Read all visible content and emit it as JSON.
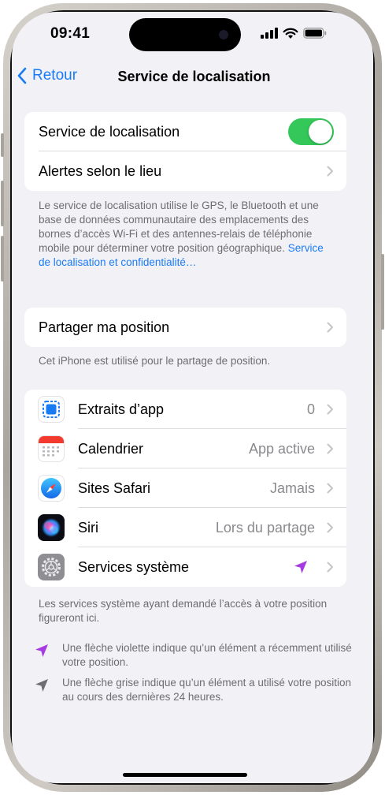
{
  "status_bar": {
    "time": "09:41"
  },
  "nav": {
    "back_label": "Retour",
    "title": "Service de localisation"
  },
  "location_group": {
    "toggle": {
      "label": "Service de localisation",
      "on": true
    },
    "alerts": {
      "label": "Alertes selon le lieu"
    }
  },
  "location_footer": {
    "text": "Le service de localisation utilise le GPS, le Bluetooth et une base de données communautaire des emplacements des bornes d’accès Wi-Fi et des antennes-relais de téléphonie mobile pour déterminer votre position géographique.",
    "link": "Service de localisation et confidentialité…"
  },
  "share_group": {
    "label": "Partager ma position"
  },
  "share_footer": "Cet iPhone est utilisé pour le partage de position.",
  "apps": [
    {
      "label": "Extraits d’app",
      "value": "0",
      "icon": "app-clips-icon"
    },
    {
      "label": "Calendrier",
      "value": "App active",
      "icon": "calendar-icon"
    },
    {
      "label": "Sites Safari",
      "value": "Jamais",
      "icon": "safari-icon"
    },
    {
      "label": "Siri",
      "value": "Lors du partage",
      "icon": "siri-icon"
    },
    {
      "label": "Services système",
      "value": "",
      "icon": "settings-gear-icon"
    }
  ],
  "apps_footer": "Les services système ayant demandé l’accès à votre position figureront ici.",
  "legend": {
    "purple": "Une flèche violette indique qu’un élément a récemment utilisé votre position.",
    "gray": "Une flèche grise indique qu’un élément a utilisé votre position au cours des dernières 24 heures."
  },
  "colors": {
    "accent": "#1a7cf5",
    "toggle_on": "#34c759",
    "purple_arrow": "#a53be0",
    "gray_arrow": "#6d6d72"
  }
}
